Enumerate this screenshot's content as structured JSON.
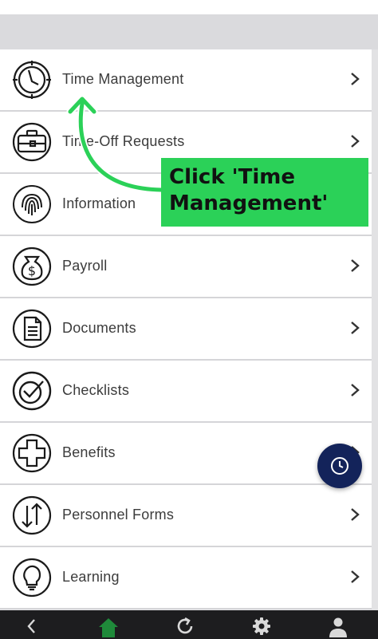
{
  "menu": {
    "items": [
      {
        "label": "Time Management",
        "icon": "clock-icon"
      },
      {
        "label": "Time-Off Requests",
        "icon": "suitcase-icon"
      },
      {
        "label": "Information",
        "icon": "fingerprint-icon"
      },
      {
        "label": "Payroll",
        "icon": "money-bag-icon"
      },
      {
        "label": "Documents",
        "icon": "document-icon"
      },
      {
        "label": "Checklists",
        "icon": "checklist-icon"
      },
      {
        "label": "Benefits",
        "icon": "medical-cross-icon"
      },
      {
        "label": "Personnel Forms",
        "icon": "transfer-arrows-icon"
      },
      {
        "label": "Learning",
        "icon": "lightbulb-icon"
      }
    ]
  },
  "callout": {
    "text": "Click 'Time\nManagement'",
    "color": "#2bd158"
  },
  "fab": {
    "icon": "clock-icon",
    "color": "#13235a"
  },
  "bottom_nav": {
    "items": [
      {
        "icon": "back-icon"
      },
      {
        "icon": "home-icon",
        "color": "#1f8a3a"
      },
      {
        "icon": "refresh-icon"
      },
      {
        "icon": "gear-icon"
      },
      {
        "icon": "user-icon"
      }
    ]
  }
}
